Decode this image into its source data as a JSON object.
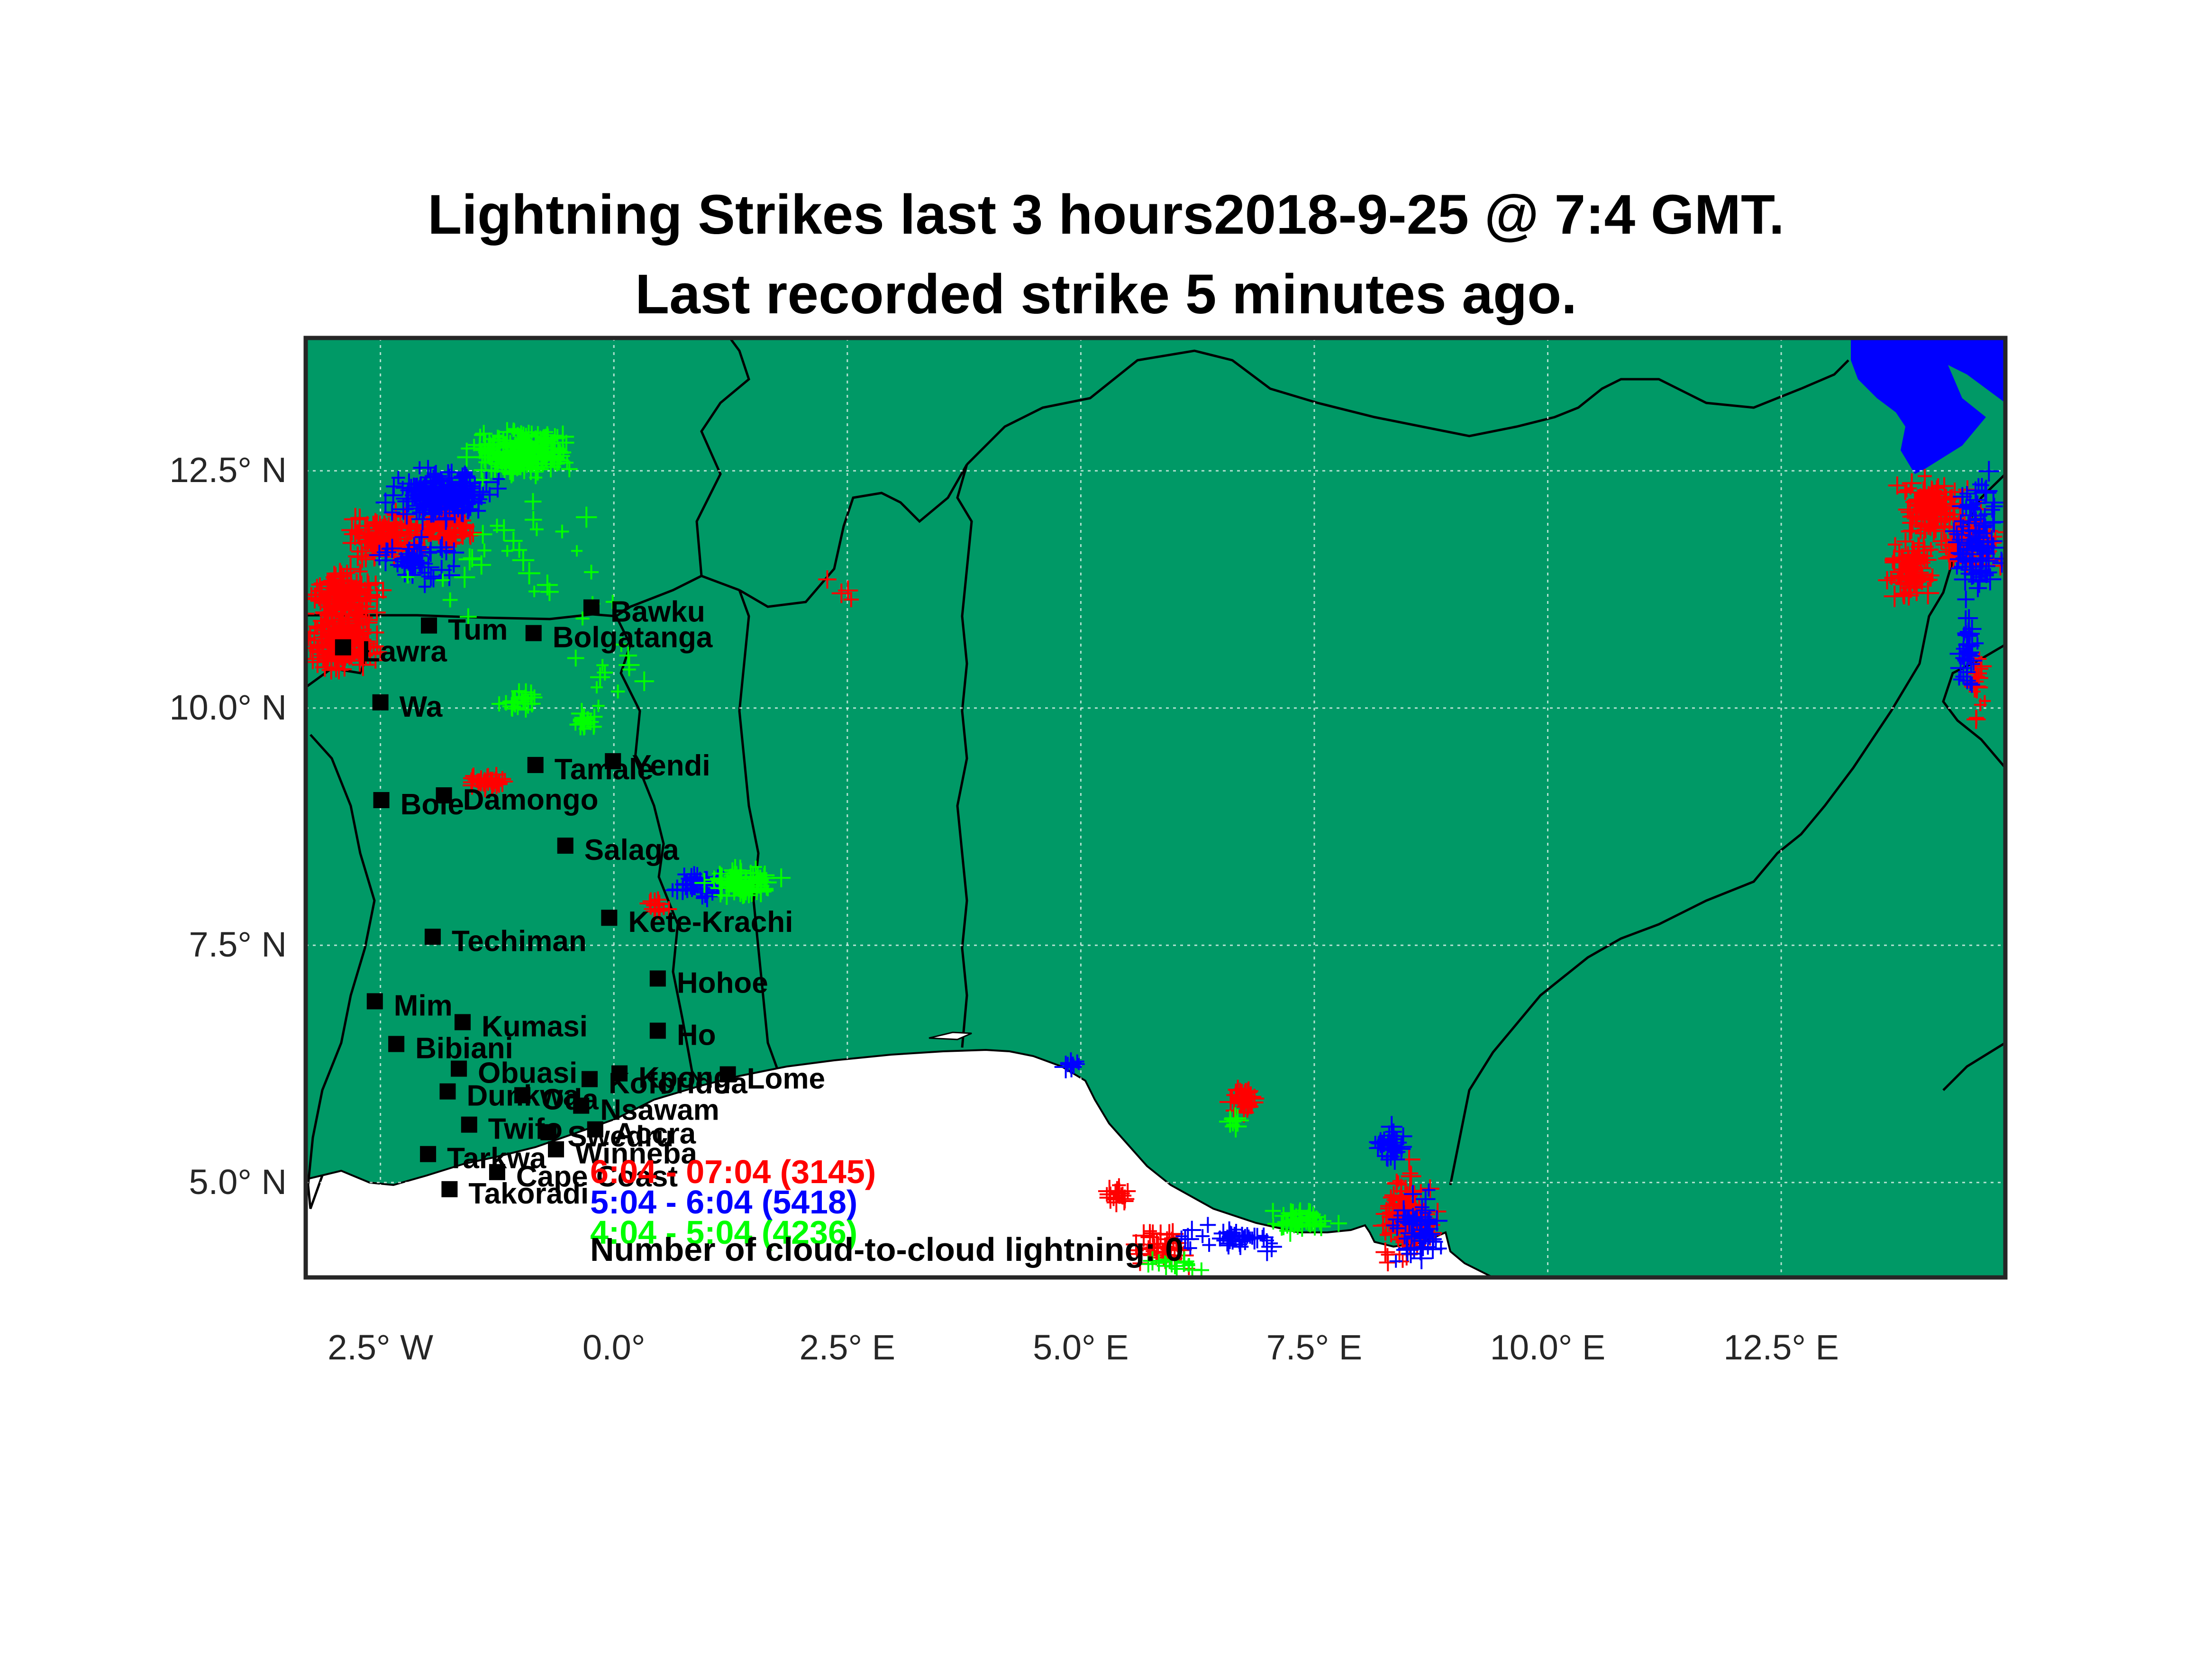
{
  "title": {
    "line1": "Lightning Strikes last 3 hours2018-9-25 @ 7:4 GMT.",
    "line2": "Last recorded strike 5 minutes ago."
  },
  "map": {
    "lon_range": [
      -3.3,
      14.9
    ],
    "lat_range": [
      4.0,
      13.9
    ],
    "land_color": "#009966",
    "sea_color": "#ffffff",
    "lake_color": "#0000ff",
    "border_color": "#000000",
    "grid": true,
    "lon_ticks": [
      {
        "value": -2.5,
        "label": "2.5° W"
      },
      {
        "value": 0.0,
        "label": "0.0°"
      },
      {
        "value": 2.5,
        "label": "2.5° E"
      },
      {
        "value": 5.0,
        "label": "5.0° E"
      },
      {
        "value": 7.5,
        "label": "7.5° E"
      },
      {
        "value": 10.0,
        "label": "10.0° E"
      },
      {
        "value": 12.5,
        "label": "12.5° E"
      }
    ],
    "lat_ticks": [
      {
        "value": 12.5,
        "label": "12.5° N"
      },
      {
        "value": 10.0,
        "label": "10.0° N"
      },
      {
        "value": 7.5,
        "label": "7.5° N"
      },
      {
        "value": 5.0,
        "label": "5.0° N"
      }
    ]
  },
  "cities": [
    {
      "name": "Bawku",
      "lon": -0.24,
      "lat": 11.06
    },
    {
      "name": "Tum",
      "lon": -1.98,
      "lat": 10.87
    },
    {
      "name": "Bolgatanga",
      "lon": -0.86,
      "lat": 10.79
    },
    {
      "name": "Lawra",
      "lon": -2.9,
      "lat": 10.64
    },
    {
      "name": "Wa",
      "lon": -2.5,
      "lat": 10.06
    },
    {
      "name": "Tamale",
      "lon": -0.84,
      "lat": 9.4
    },
    {
      "name": "Yendi",
      "lon": -0.01,
      "lat": 9.44
    },
    {
      "name": "Bole",
      "lon": -2.49,
      "lat": 9.03
    },
    {
      "name": "Damongo",
      "lon": -1.82,
      "lat": 9.08
    },
    {
      "name": "Salaga",
      "lon": -0.52,
      "lat": 8.55
    },
    {
      "name": "Kete-Krachi",
      "lon": -0.05,
      "lat": 7.79
    },
    {
      "name": "Techiman",
      "lon": -1.94,
      "lat": 7.59
    },
    {
      "name": "Hohoe",
      "lon": 0.47,
      "lat": 7.15
    },
    {
      "name": "Mim",
      "lon": -2.56,
      "lat": 6.91
    },
    {
      "name": "Kumasi",
      "lon": -1.62,
      "lat": 6.69
    },
    {
      "name": "Ho",
      "lon": 0.47,
      "lat": 6.6
    },
    {
      "name": "Bibiani",
      "lon": -2.33,
      "lat": 6.46
    },
    {
      "name": "Obuasi",
      "lon": -1.66,
      "lat": 6.2
    },
    {
      "name": "Koforidua",
      "lon": -0.26,
      "lat": 6.09
    },
    {
      "name": "Kpong",
      "lon": 0.06,
      "lat": 6.15
    },
    {
      "name": "Lome",
      "lon": 1.22,
      "lat": 6.14
    },
    {
      "name": "Dunkwa",
      "lon": -1.78,
      "lat": 5.96
    },
    {
      "name": "Oda",
      "lon": -0.98,
      "lat": 5.92
    },
    {
      "name": "Twifo",
      "lon": -1.55,
      "lat": 5.61
    },
    {
      "name": "Nsawam",
      "lon": -0.35,
      "lat": 5.81
    },
    {
      "name": "Accra",
      "lon": -0.2,
      "lat": 5.56
    },
    {
      "name": "Swedru",
      "lon": -0.7,
      "lat": 5.53
    },
    {
      "name": "Winneba",
      "lon": -0.62,
      "lat": 5.35
    },
    {
      "name": "Tarkwa",
      "lon": -1.99,
      "lat": 5.3
    },
    {
      "name": "Cape Coast",
      "lon": -1.25,
      "lat": 5.11
    },
    {
      "name": "Takoradi",
      "lon": -1.76,
      "lat": 4.93
    }
  ],
  "legend": [
    {
      "label": "6:04 - 07:04 (3145)",
      "color": "#ff0000"
    },
    {
      "label": "5:04 - 6:04 (5418)",
      "color": "#0000ff"
    },
    {
      "label": "4:04 - 5:04 (4236)",
      "color": "#00ff00"
    }
  ],
  "cloud_to_cloud_label": "Number of cloud-to-cloud lightning: 0",
  "strike_clusters": [
    {
      "period": "6:04 - 07:04",
      "color": "#ff0000",
      "lon": -2.9,
      "lat": 11.15,
      "spread_lon": 0.3,
      "spread_lat": 0.25,
      "count": 160
    },
    {
      "period": "6:04 - 07:04",
      "color": "#ff0000",
      "lon": -2.9,
      "lat": 10.65,
      "spread_lon": 0.3,
      "spread_lat": 0.2,
      "count": 160
    },
    {
      "period": "6:04 - 07:04",
      "color": "#ff0000",
      "lon": -2.4,
      "lat": 11.8,
      "spread_lon": 0.35,
      "spread_lat": 0.2,
      "count": 110
    },
    {
      "period": "6:04 - 07:04",
      "color": "#ff0000",
      "lon": -1.8,
      "lat": 11.95,
      "spread_lon": 0.25,
      "spread_lat": 0.15,
      "count": 70
    },
    {
      "period": "6:04 - 07:04",
      "color": "#ff0000",
      "lon": -1.35,
      "lat": 9.22,
      "spread_lon": 0.15,
      "spread_lat": 0.06,
      "count": 35
    },
    {
      "period": "6:04 - 07:04",
      "color": "#ff0000",
      "lon": 0.45,
      "lat": 7.9,
      "spread_lon": 0.1,
      "spread_lat": 0.08,
      "count": 12
    },
    {
      "period": "6:04 - 07:04",
      "color": "#ff0000",
      "lon": 2.5,
      "lat": 11.25,
      "spread_lon": 0.25,
      "spread_lat": 0.1,
      "count": 4
    },
    {
      "period": "6:04 - 07:04",
      "color": "#ff0000",
      "lon": 6.75,
      "lat": 5.88,
      "spread_lon": 0.12,
      "spread_lat": 0.1,
      "count": 35
    },
    {
      "period": "6:04 - 07:04",
      "color": "#ff0000",
      "lon": 5.4,
      "lat": 4.88,
      "spread_lon": 0.1,
      "spread_lat": 0.08,
      "count": 15
    },
    {
      "period": "6:04 - 07:04",
      "color": "#ff0000",
      "lon": 5.9,
      "lat": 4.3,
      "spread_lon": 0.25,
      "spread_lat": 0.15,
      "count": 45
    },
    {
      "period": "6:04 - 07:04",
      "color": "#ff0000",
      "lon": 8.5,
      "lat": 4.65,
      "spread_lon": 0.2,
      "spread_lat": 0.35,
      "count": 110
    },
    {
      "period": "6:04 - 07:04",
      "color": "#ff0000",
      "lon": 14.1,
      "lat": 12.1,
      "spread_lon": 0.25,
      "spread_lat": 0.25,
      "count": 110
    },
    {
      "period": "6:04 - 07:04",
      "color": "#ff0000",
      "lon": 14.55,
      "lat": 11.75,
      "spread_lon": 0.25,
      "spread_lat": 0.2,
      "count": 90
    },
    {
      "period": "6:04 - 07:04",
      "color": "#ff0000",
      "lon": 13.9,
      "lat": 11.45,
      "spread_lon": 0.2,
      "spread_lat": 0.25,
      "count": 90
    },
    {
      "period": "6:04 - 07:04",
      "color": "#ff0000",
      "lon": 14.6,
      "lat": 10.25,
      "spread_lon": 0.05,
      "spread_lat": 0.3,
      "count": 18
    },
    {
      "period": "5:04 - 6:04",
      "color": "#0000ff",
      "lon": -1.8,
      "lat": 12.25,
      "spread_lon": 0.4,
      "spread_lat": 0.2,
      "count": 220
    },
    {
      "period": "5:04 - 6:04",
      "color": "#0000ff",
      "lon": -2.1,
      "lat": 11.55,
      "spread_lon": 0.3,
      "spread_lat": 0.2,
      "count": 50
    },
    {
      "period": "5:04 - 6:04",
      "color": "#0000ff",
      "lon": 0.9,
      "lat": 8.15,
      "spread_lon": 0.2,
      "spread_lat": 0.1,
      "count": 45
    },
    {
      "period": "5:04 - 6:04",
      "color": "#0000ff",
      "lon": 4.9,
      "lat": 6.25,
      "spread_lon": 0.06,
      "spread_lat": 0.05,
      "count": 10
    },
    {
      "period": "5:04 - 6:04",
      "color": "#0000ff",
      "lon": 6.6,
      "lat": 4.4,
      "spread_lon": 0.4,
      "spread_lat": 0.1,
      "count": 40
    },
    {
      "period": "5:04 - 6:04",
      "color": "#0000ff",
      "lon": 8.3,
      "lat": 5.4,
      "spread_lon": 0.12,
      "spread_lat": 0.12,
      "count": 30
    },
    {
      "period": "5:04 - 6:04",
      "color": "#0000ff",
      "lon": 8.6,
      "lat": 4.55,
      "spread_lon": 0.2,
      "spread_lat": 0.3,
      "count": 60
    },
    {
      "period": "5:04 - 6:04",
      "color": "#0000ff",
      "lon": 14.6,
      "lat": 11.8,
      "spread_lon": 0.2,
      "spread_lat": 0.45,
      "count": 100
    },
    {
      "period": "5:04 - 6:04",
      "color": "#0000ff",
      "lon": 14.5,
      "lat": 10.6,
      "spread_lon": 0.1,
      "spread_lat": 0.35,
      "count": 35
    },
    {
      "period": "4:04 - 5:04",
      "color": "#00ff00",
      "lon": -1.0,
      "lat": 12.7,
      "spread_lon": 0.4,
      "spread_lat": 0.2,
      "count": 230
    },
    {
      "period": "4:04 - 5:04",
      "color": "#00ff00",
      "lon": -0.8,
      "lat": 11.6,
      "spread_lon": 0.8,
      "spread_lat": 0.5,
      "count": 30
    },
    {
      "period": "4:04 - 5:04",
      "color": "#00ff00",
      "lon": -1.0,
      "lat": 10.1,
      "spread_lon": 0.2,
      "spread_lat": 0.1,
      "count": 20
    },
    {
      "period": "4:04 - 5:04",
      "color": "#00ff00",
      "lon": -0.3,
      "lat": 9.85,
      "spread_lon": 0.15,
      "spread_lat": 0.1,
      "count": 15
    },
    {
      "period": "4:04 - 5:04",
      "color": "#00ff00",
      "lon": 0.0,
      "lat": 10.4,
      "spread_lon": 0.4,
      "spread_lat": 0.3,
      "count": 12
    },
    {
      "period": "4:04 - 5:04",
      "color": "#00ff00",
      "lon": 1.35,
      "lat": 8.15,
      "spread_lon": 0.25,
      "spread_lat": 0.12,
      "count": 90
    },
    {
      "period": "4:04 - 5:04",
      "color": "#00ff00",
      "lon": 7.35,
      "lat": 4.6,
      "spread_lon": 0.25,
      "spread_lat": 0.1,
      "count": 45
    },
    {
      "period": "4:04 - 5:04",
      "color": "#00ff00",
      "lon": 6.0,
      "lat": 4.15,
      "spread_lon": 0.25,
      "spread_lat": 0.07,
      "count": 15
    },
    {
      "period": "4:04 - 5:04",
      "color": "#00ff00",
      "lon": 6.65,
      "lat": 5.65,
      "spread_lon": 0.05,
      "spread_lat": 0.05,
      "count": 6
    }
  ]
}
